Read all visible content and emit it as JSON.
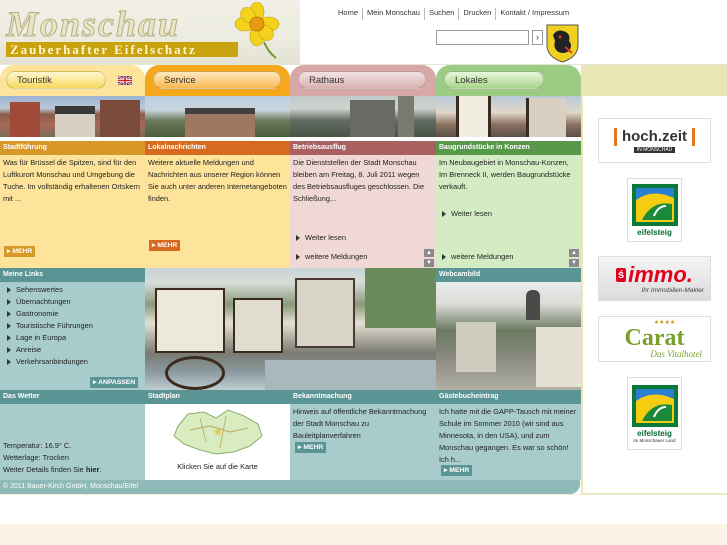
{
  "logo": {
    "title": "Monschau",
    "subtitle": "Zauberhafter Eifelschatz"
  },
  "topnav": [
    "Home",
    "Mein Monschau",
    "Suchen",
    "Drucken",
    "Kontakt / Impressum"
  ],
  "search": {
    "value": "",
    "button": "›"
  },
  "colors": {
    "orange_light": "#fde49a",
    "orange": "#f6a81c",
    "rose": "#d8a8a8",
    "green": "#9ccc84",
    "teal": "#78a8a8",
    "gold": "#c9a30e"
  },
  "columns": {
    "touristik": {
      "tab": "Touristik",
      "section": "Stadtführung",
      "text": "Was für Brüssel die Spitzen, sind für den Luftkurort Monschau und Umgebung die Tuche. Im vollständig erhaltenen Ortskern mit ...",
      "mehr": "MEHR"
    },
    "service": {
      "tab": "Service",
      "section": "Lokalnachrichten",
      "text": "Weitere aktuelle Meldungen und Nachrichten aus unserer Region können Sie auch unter anderen Internetangeboten finden.",
      "mehr": "MEHR"
    },
    "rathaus": {
      "tab": "Rathaus",
      "section": "Betriebsausflug",
      "text": "Die Dienststellen der Stadt Monschau bleiben am Freitag, 8. Juli 2011 wegen des Betriebsausfluges geschlossen. Die Schließung...",
      "link1": "Weiter lesen",
      "link2": "weitere Meldungen"
    },
    "lokales": {
      "tab": "Lokales",
      "section": "Baugrundstücke in Konzen",
      "text": "Im Neubaugebiet in Monschau-Konzen, Im Brenneck II, werden Baugrundstücke verkauft.",
      "link1": "Weiter lesen",
      "link2": "weitere Meldungen"
    }
  },
  "links": {
    "heading": "Meine Links",
    "items": [
      "Sehenswertes",
      "Übernachtungen",
      "Gastronomie",
      "Touristische Führungen",
      "Lage in Europa",
      "Anreise",
      "Verkehrsanbindungen"
    ],
    "button": "ANPASSEN"
  },
  "webcam": {
    "heading": "Webcambild"
  },
  "weather": {
    "heading": "Das Wetter",
    "temp": "Temperatur: 16.9° C.",
    "state": "Wetterlage: Trocken",
    "more_prefix": "Weiter Details finden Sie ",
    "more_link": "hier",
    "more_suffix": "."
  },
  "stadtplan": {
    "heading": "Stadtplan",
    "caption": "Klicken Sie auf die Karte"
  },
  "bekannt": {
    "heading": "Bekanntmachung",
    "text": "Hinweis auf öffentliche Bekanntmachung der Stadt Monschau zu Bauleitplanverfahren",
    "mehr": "MEHR"
  },
  "guestbook": {
    "heading": "Gästebucheintrag",
    "text": "Ich hatte mit die GAPP-Tausch mit meiner Schule im Sommer 2010 (wir sind aus Minnesota, in den USA), und zum Monschau gegangen. Es war so schön! Ich h...",
    "mehr": "MEHR"
  },
  "footer": "© 2011 Bauer-Kirch GmbH, Monschau/Eifel",
  "ads": {
    "hochzeit": {
      "title": "hoch.zeit",
      "sub": "IN MONSCHAU"
    },
    "eifelsteig1": {
      "label": "eifelsteig"
    },
    "immo": {
      "title": "immo.",
      "sub": "Ihr Immobilien-Makler"
    },
    "carat": {
      "title": "Carat",
      "sub": "Das Vitalhotel",
      "stars": "★★★★"
    },
    "eifelsteig2": {
      "label": "eifelsteig",
      "sub": "im Monschauer Land"
    }
  }
}
